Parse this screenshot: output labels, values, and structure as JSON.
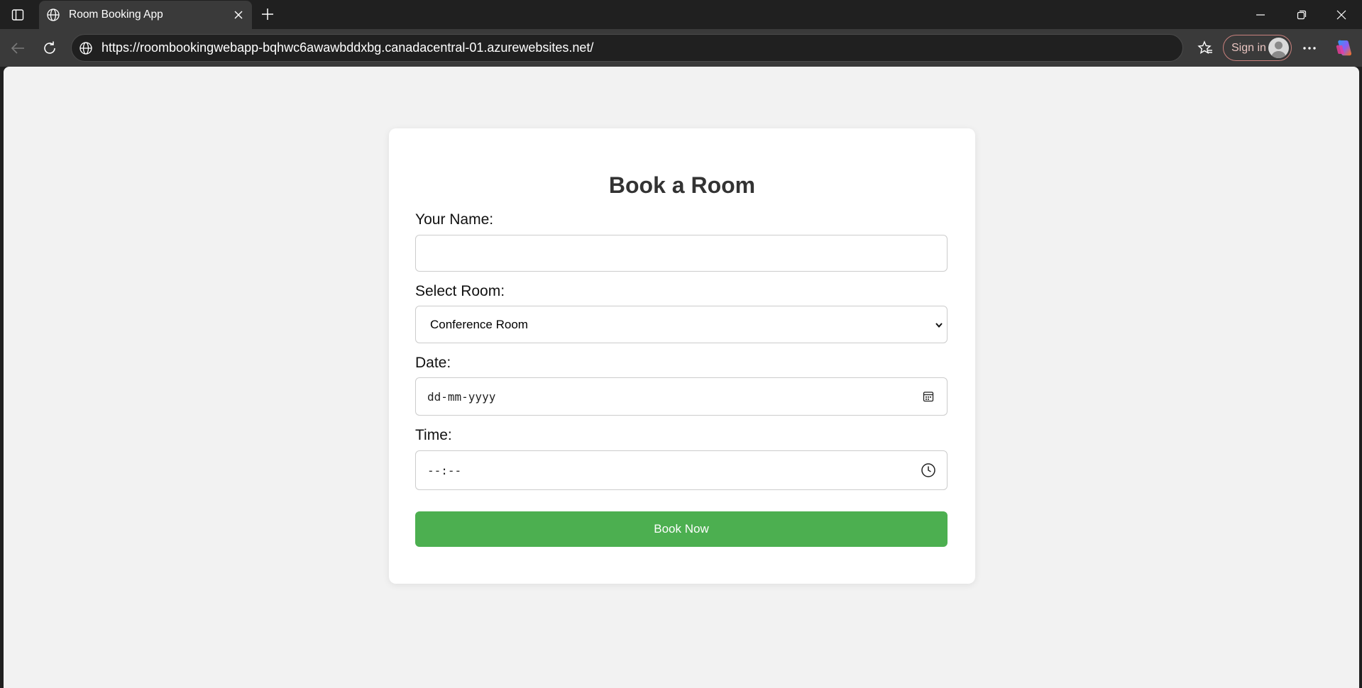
{
  "browser": {
    "tab_title": "Room Booking App",
    "url": "https://roombookingwebapp-bqhwc6awawbddxbg.canadacentral-01.azurewebsites.net/",
    "signin_label": "Sign in"
  },
  "form": {
    "title": "Book a Room",
    "name_label": "Your Name:",
    "name_value": "",
    "room_label": "Select Room:",
    "room_selected": "Conference Room",
    "date_label": "Date:",
    "date_placeholder": "dd-mm-yyyy",
    "time_label": "Time:",
    "time_placeholder": "--:--",
    "submit_label": "Book Now"
  },
  "colors": {
    "accent_button": "#4caf50",
    "page_background": "#f2f2f2"
  },
  "icons": [
    "sidebar-icon",
    "globe-icon",
    "close-icon",
    "plus-icon",
    "back-icon",
    "refresh-icon",
    "favorites-icon",
    "more-icon",
    "copilot-icon",
    "calendar-icon",
    "clock-icon",
    "chevron-down-icon"
  ]
}
